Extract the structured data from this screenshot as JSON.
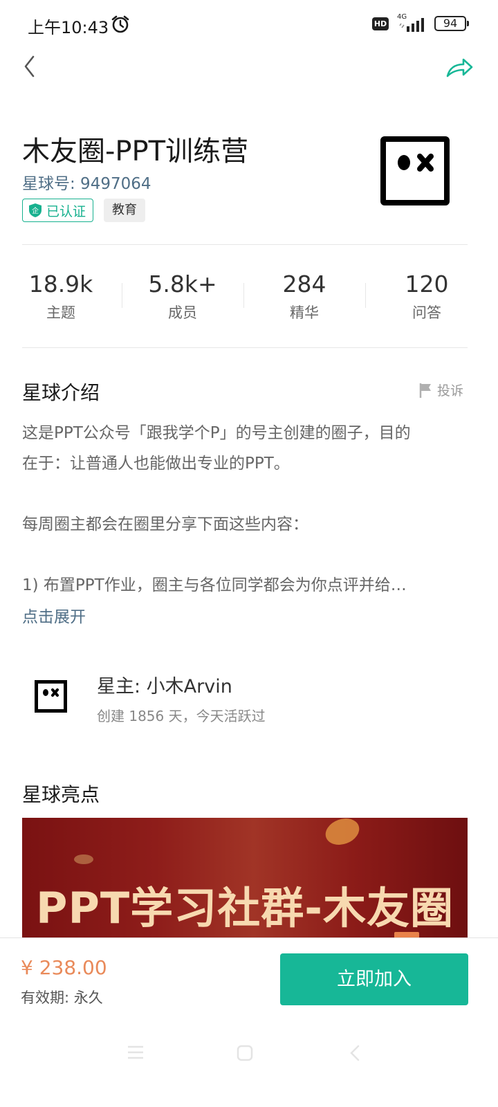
{
  "status_bar": {
    "time": "上午10:43",
    "hd": "HD",
    "network": "4G",
    "battery": "94"
  },
  "header": {
    "title": "木友圈-PPT训练营",
    "group_id": "星球号: 9497064",
    "verified_label": "已认证",
    "verified_icon_char": "企",
    "category": "教育"
  },
  "stats": [
    {
      "value": "18.9k",
      "label": "主题"
    },
    {
      "value": "5.8k+",
      "label": "成员"
    },
    {
      "value": "284",
      "label": "精华"
    },
    {
      "value": "120",
      "label": "问答"
    }
  ],
  "intro": {
    "title": "星球介绍",
    "report_label": "投诉",
    "lines": [
      "这是PPT公众号「跟我学个P」的号主创建的圈子，目的",
      "在于：让普通人也能做出专业的PPT。",
      "",
      "每周圈主都会在圈里分享下面这些内容：",
      "",
      "1) 布置PPT作业，圈主与各位同学都会为你点评并给…"
    ],
    "expand_label": "点击展开"
  },
  "owner": {
    "name": "星主: 小木Arvin",
    "meta": "创建 1856 天，今天活跃过"
  },
  "highlights": {
    "title": "星球亮点",
    "banner_text": "PPT学习社群-木友圈"
  },
  "footer": {
    "price": "¥ 238.00",
    "validity": "有效期: 永久",
    "join_label": "立即加入"
  },
  "colors": {
    "accent": "#17b797",
    "link": "#4f6e86",
    "price": "#e98a5a"
  }
}
